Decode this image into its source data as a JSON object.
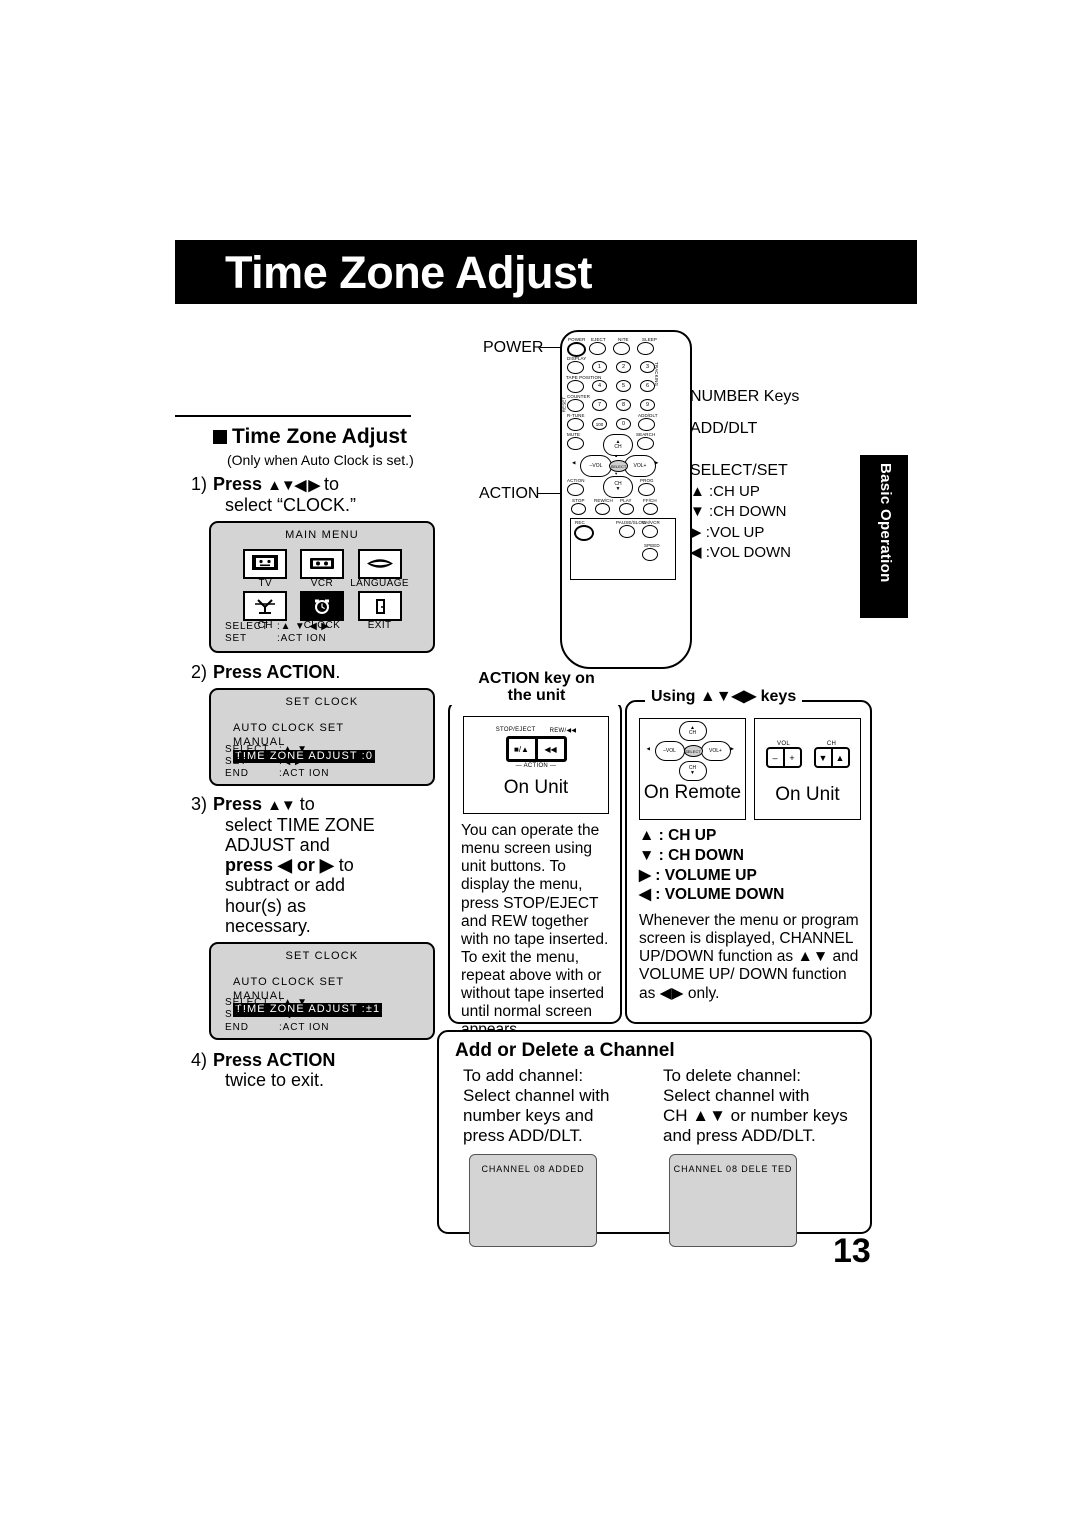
{
  "header": {
    "title": "Time Zone Adjust"
  },
  "side_tab": {
    "label": "Basic Operation"
  },
  "page_number": "13",
  "left": {
    "section_title": "Time Zone Adjust",
    "note": "(Only when Auto Clock is set.)",
    "steps": [
      {
        "num": "1)",
        "bold1": "Press",
        "arrows": "▲▼◀ ▶",
        "rest1": "to",
        "line2": "select “CLOCK.”"
      },
      {
        "num": "2)",
        "bold1": "Press ACTION",
        "rest1": "."
      },
      {
        "num": "3)",
        "bold1": "Press",
        "arrows": "▲▼",
        "rest1": "to",
        "line2": "select TIME ZONE",
        "line3": "ADJUST and",
        "line4bold": "press ◀ or ▶",
        "line4rest": "to",
        "line5": "subtract or add",
        "line6": "hour(s) as",
        "line7": "necessary."
      },
      {
        "num": "4)",
        "bold1": "Press ACTION",
        "line2": "twice to exit."
      }
    ],
    "main_menu": {
      "title": "MAIN MENU",
      "items": [
        {
          "label": "TV",
          "icon": "tv-icon",
          "selected": false
        },
        {
          "label": "VCR",
          "icon": "cassette-icon",
          "selected": false
        },
        {
          "label": "LANGUAGE",
          "icon": "mouth-icon",
          "selected": false
        },
        {
          "label": "CH",
          "icon": "antenna-icon",
          "selected": false
        },
        {
          "label": "CLOCK",
          "icon": "alarm-clock-icon",
          "selected": true
        },
        {
          "label": "EXIT",
          "icon": "door-icon",
          "selected": false
        }
      ],
      "footer": [
        {
          "key": "SELECT",
          "val": ":▲ ▼ ◀ ▶"
        },
        {
          "key": "SET",
          "val": ":ACT ION"
        }
      ]
    },
    "set_clock_1": {
      "title": "SET CLOCK",
      "rows": [
        "AUTO  CLOCK  SET",
        "MANUAL"
      ],
      "highlight": "TIME  ZONE  ADJUST   :0",
      "footer": [
        {
          "key": "SELECT",
          "val": ":▲ ▼"
        },
        {
          "key": "SET",
          "val": ":◀ ▶"
        },
        {
          "key": "END",
          "val": ":ACT ION"
        }
      ]
    },
    "set_clock_2": {
      "title": "SET CLOCK",
      "rows": [
        "AUTO  CLOCK  SET",
        "MANUAL"
      ],
      "highlight": "TIME  ZONE  ADJUST   :±1",
      "footer": [
        {
          "key": "SELECT",
          "val": ":▲ ▼"
        },
        {
          "key": "SET",
          "val": ":◀"
        },
        {
          "key": "END",
          "val": ":ACT ION"
        }
      ]
    }
  },
  "remote": {
    "callouts": {
      "power": "POWER",
      "action": "ACTION",
      "number_keys": "NUMBER  Keys",
      "add_dlt": "ADD/DLT",
      "select_set": "SELECT/SET",
      "ch_up": "▲ :CH UP",
      "ch_down": "▼ :CH DOWN",
      "vol_up": "▶ :VOL UP",
      "vol_down": "◀ :VOL DOWN"
    },
    "keys": {
      "power": "POWER",
      "eject": "EJECT",
      "nite": "NITE",
      "sleep": "SLEEP",
      "display": "DISPLAY",
      "tape_position": "TAPE POSITION",
      "counter": "COUNTER",
      "reset": "RESET",
      "r_tune": "R-TUNE",
      "mute": "MUTE",
      "search": "SEARCH",
      "add_dlt": "ADD/DLT",
      "tracking": "TRACKING",
      "action": "ACTION",
      "prog": "PROG",
      "stop": "STOP",
      "rew": "REW/CH",
      "play": "PLAY",
      "ffwd": "FF/CH",
      "rec": "REC",
      "pause_slow": "PAUSE/SLOW",
      "ch_vcr": "CH/VCR",
      "speed": "SPEED",
      "ch_top": "CH",
      "ch_bottom": "CH",
      "vol_minus": "–VOL",
      "vol_plus": "VOL+",
      "select": "SELECT",
      "numbers": [
        "1",
        "2",
        "3",
        "4",
        "5",
        "6",
        "7",
        "8",
        "9",
        "100",
        "0"
      ]
    }
  },
  "action_box": {
    "legend_line1": "ACTION key on",
    "legend_line2": "the unit",
    "unit_caption": "On Unit",
    "btn_left_label": "STOP/EJECT",
    "btn_right_label": "REW/◀◀",
    "btn_left_glyph": "■/▲",
    "btn_right_glyph": "◀◀",
    "action_tag": "— ACTION —",
    "paragraph": "You can operate the menu screen using unit buttons. To display the menu, press STOP/EJECT and REW together with no tape inserted. To exit the menu, repeat above with or without tape inserted until normal screen appears."
  },
  "keys_box": {
    "legend": "Using ▲▼◀▶ keys",
    "remote_caption": "On Remote",
    "unit_caption": "On Unit",
    "vol_label": "VOL",
    "ch_label": "CH",
    "vol_minus": "–",
    "vol_plus": "+",
    "ch_down_glyph": "▼",
    "ch_up_glyph": "▲",
    "remote_pad": {
      "ch_top": "CH",
      "ch_bottom": "CH",
      "vol_minus": "–VOL",
      "vol_plus": "VOL+",
      "select": "SELECT"
    },
    "mapping": [
      "▲ : CH UP",
      "▼ : CH DOWN",
      "▶ : VOLUME UP",
      "◀ : VOLUME DOWN"
    ],
    "paragraph": "Whenever the menu or program screen is displayed, CHANNEL UP/DOWN function as ▲▼ and VOLUME UP/ DOWN function as ◀▶ only."
  },
  "add_delete": {
    "heading": "Add or Delete a Channel",
    "add": {
      "title": "To add channel:",
      "line1": "Select channel with",
      "line2": "number keys and",
      "line3": "press ADD/DLT.",
      "screen": "CHANNEL  08  ADDED"
    },
    "delete": {
      "title": "To delete channel:",
      "line1": "Select channel with",
      "line2": "CH ▲▼ or number keys",
      "line3": "and press ADD/DLT.",
      "screen": "CHANNEL  08  DELE TED"
    }
  },
  "colors": {
    "ink": "#000000",
    "osd_gray": "#d4d4d4",
    "paper": "#ffffff"
  }
}
